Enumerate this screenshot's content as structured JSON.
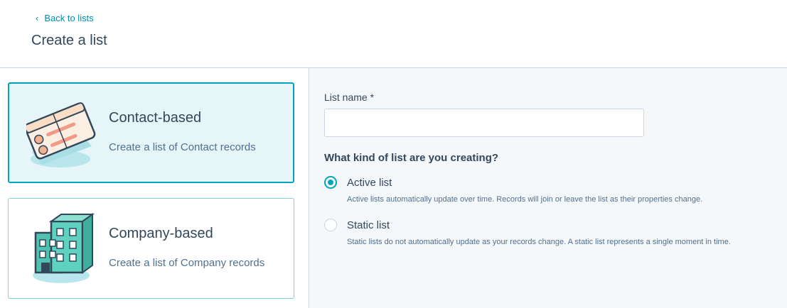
{
  "header": {
    "back_label": "Back to lists",
    "title": "Create a list"
  },
  "cards": {
    "contact": {
      "title": "Contact-based",
      "description": "Create a list of Contact records",
      "icon": "contact-cards-icon",
      "selected": true
    },
    "company": {
      "title": "Company-based",
      "description": "Create a list of Company records",
      "icon": "building-icon",
      "selected": false
    }
  },
  "form": {
    "list_name_label": "List name *",
    "list_name_value": "",
    "question": "What kind of list are you creating?",
    "options": [
      {
        "label": "Active list",
        "help": "Active lists automatically update over time. Records will join or leave the list as their properties change.",
        "checked": true
      },
      {
        "label": "Static list",
        "help": "Static lists do not automatically update as your records change. A static list represents a single moment in time.",
        "checked": false
      }
    ]
  },
  "colors": {
    "accent": "#00a4bd",
    "link": "#0091ae",
    "text": "#33475b",
    "muted": "#516f90",
    "border": "#cbd6e2",
    "panel_bg": "#f5f8fa",
    "selected_bg": "#e5f5f8"
  }
}
